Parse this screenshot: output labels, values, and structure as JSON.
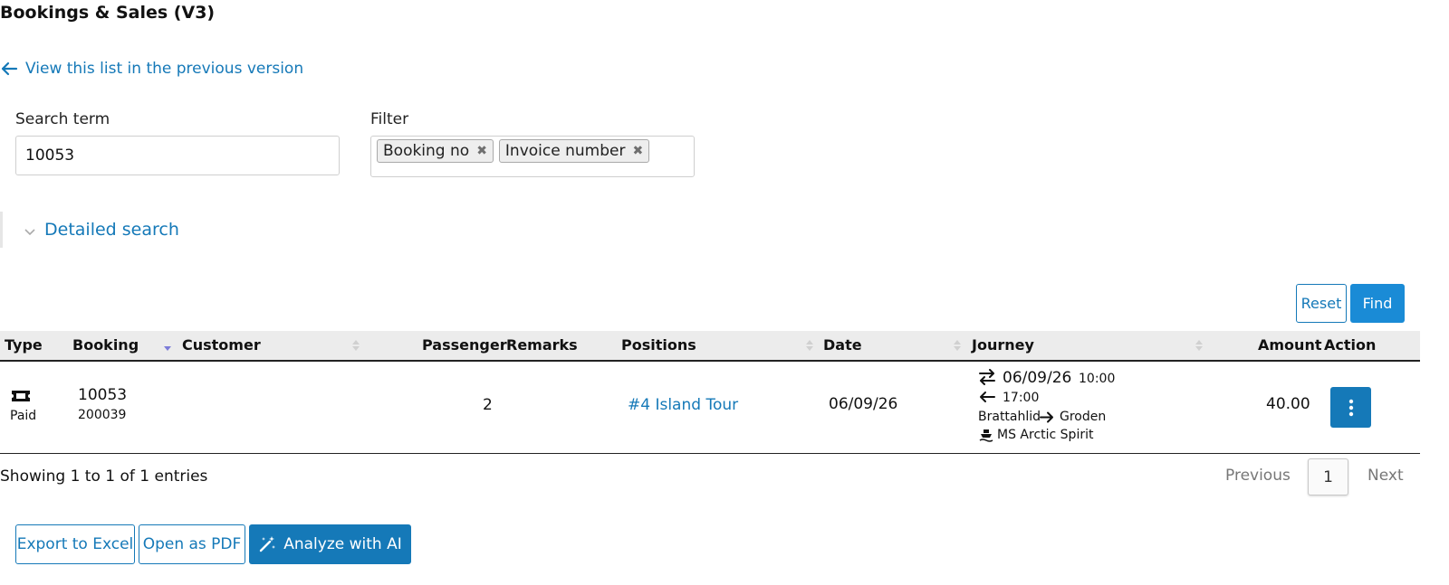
{
  "page": {
    "title": "Bookings & Sales (V3)",
    "prev_version_link": "View this list in the previous version"
  },
  "search": {
    "term_label": "Search term",
    "term_value": "10053",
    "filter_label": "Filter",
    "filter_tags": [
      "Booking no",
      "Invoice number"
    ],
    "detailed_search_label": "Detailed search"
  },
  "buttons": {
    "reset": "Reset",
    "find": "Find",
    "export_excel": "Export to Excel",
    "open_pdf": "Open as PDF",
    "analyze_ai": "Analyze with AI"
  },
  "table": {
    "columns": [
      "Type",
      "Booking",
      "Customer",
      "Passenger",
      "Remarks",
      "Positions",
      "Date",
      "Journey",
      "Amount",
      "Action"
    ],
    "rows": [
      {
        "type_icon": "ticket-icon",
        "type_label": "Paid",
        "booking_no": "10053",
        "booking_sub": "200039",
        "customer": "",
        "passenger": "2",
        "remarks": "",
        "position": "#4 Island Tour",
        "date": "06/09/26",
        "journey": {
          "outbound_date": "06/09/26",
          "outbound_time": "10:00",
          "return_time": "17:00",
          "from": "Brattahlid",
          "to": "Groden",
          "vessel": "MS Arctic Spirit"
        },
        "amount": "40.00"
      }
    ]
  },
  "footer": {
    "showing": "Showing 1 to 1 of 1 entries",
    "previous": "Previous",
    "page": "1",
    "next": "Next"
  },
  "colors": {
    "accent": "#1579b8",
    "button_primary": "#1a8bd6",
    "header_bg": "#ececec"
  }
}
